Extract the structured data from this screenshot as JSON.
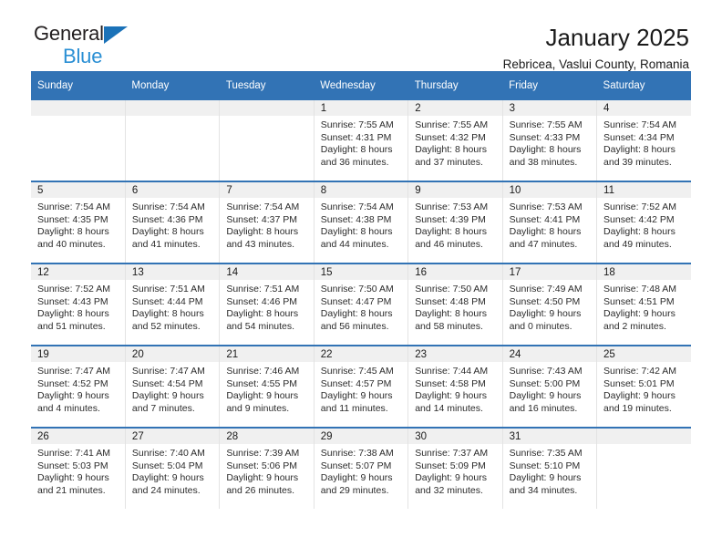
{
  "brand": {
    "name_part1": "General",
    "name_part2": "Blue",
    "triangle_color": "#1b72b8",
    "blue_color": "#2a8fd4"
  },
  "header": {
    "title": "January 2025",
    "subtitle": "Rebricea, Vaslui County, Romania"
  },
  "theme": {
    "header_bg": "#3273b5",
    "daynum_bg": "#f0f0f0",
    "row_border": "#3273b5"
  },
  "weekday_headers": [
    "Sunday",
    "Monday",
    "Tuesday",
    "Wednesday",
    "Thursday",
    "Friday",
    "Saturday"
  ],
  "weeks": [
    [
      {
        "day": "",
        "lines": []
      },
      {
        "day": "",
        "lines": []
      },
      {
        "day": "",
        "lines": []
      },
      {
        "day": "1",
        "lines": [
          "Sunrise: 7:55 AM",
          "Sunset: 4:31 PM",
          "Daylight: 8 hours",
          "and 36 minutes."
        ]
      },
      {
        "day": "2",
        "lines": [
          "Sunrise: 7:55 AM",
          "Sunset: 4:32 PM",
          "Daylight: 8 hours",
          "and 37 minutes."
        ]
      },
      {
        "day": "3",
        "lines": [
          "Sunrise: 7:55 AM",
          "Sunset: 4:33 PM",
          "Daylight: 8 hours",
          "and 38 minutes."
        ]
      },
      {
        "day": "4",
        "lines": [
          "Sunrise: 7:54 AM",
          "Sunset: 4:34 PM",
          "Daylight: 8 hours",
          "and 39 minutes."
        ]
      }
    ],
    [
      {
        "day": "5",
        "lines": [
          "Sunrise: 7:54 AM",
          "Sunset: 4:35 PM",
          "Daylight: 8 hours",
          "and 40 minutes."
        ]
      },
      {
        "day": "6",
        "lines": [
          "Sunrise: 7:54 AM",
          "Sunset: 4:36 PM",
          "Daylight: 8 hours",
          "and 41 minutes."
        ]
      },
      {
        "day": "7",
        "lines": [
          "Sunrise: 7:54 AM",
          "Sunset: 4:37 PM",
          "Daylight: 8 hours",
          "and 43 minutes."
        ]
      },
      {
        "day": "8",
        "lines": [
          "Sunrise: 7:54 AM",
          "Sunset: 4:38 PM",
          "Daylight: 8 hours",
          "and 44 minutes."
        ]
      },
      {
        "day": "9",
        "lines": [
          "Sunrise: 7:53 AM",
          "Sunset: 4:39 PM",
          "Daylight: 8 hours",
          "and 46 minutes."
        ]
      },
      {
        "day": "10",
        "lines": [
          "Sunrise: 7:53 AM",
          "Sunset: 4:41 PM",
          "Daylight: 8 hours",
          "and 47 minutes."
        ]
      },
      {
        "day": "11",
        "lines": [
          "Sunrise: 7:52 AM",
          "Sunset: 4:42 PM",
          "Daylight: 8 hours",
          "and 49 minutes."
        ]
      }
    ],
    [
      {
        "day": "12",
        "lines": [
          "Sunrise: 7:52 AM",
          "Sunset: 4:43 PM",
          "Daylight: 8 hours",
          "and 51 minutes."
        ]
      },
      {
        "day": "13",
        "lines": [
          "Sunrise: 7:51 AM",
          "Sunset: 4:44 PM",
          "Daylight: 8 hours",
          "and 52 minutes."
        ]
      },
      {
        "day": "14",
        "lines": [
          "Sunrise: 7:51 AM",
          "Sunset: 4:46 PM",
          "Daylight: 8 hours",
          "and 54 minutes."
        ]
      },
      {
        "day": "15",
        "lines": [
          "Sunrise: 7:50 AM",
          "Sunset: 4:47 PM",
          "Daylight: 8 hours",
          "and 56 minutes."
        ]
      },
      {
        "day": "16",
        "lines": [
          "Sunrise: 7:50 AM",
          "Sunset: 4:48 PM",
          "Daylight: 8 hours",
          "and 58 minutes."
        ]
      },
      {
        "day": "17",
        "lines": [
          "Sunrise: 7:49 AM",
          "Sunset: 4:50 PM",
          "Daylight: 9 hours",
          "and 0 minutes."
        ]
      },
      {
        "day": "18",
        "lines": [
          "Sunrise: 7:48 AM",
          "Sunset: 4:51 PM",
          "Daylight: 9 hours",
          "and 2 minutes."
        ]
      }
    ],
    [
      {
        "day": "19",
        "lines": [
          "Sunrise: 7:47 AM",
          "Sunset: 4:52 PM",
          "Daylight: 9 hours",
          "and 4 minutes."
        ]
      },
      {
        "day": "20",
        "lines": [
          "Sunrise: 7:47 AM",
          "Sunset: 4:54 PM",
          "Daylight: 9 hours",
          "and 7 minutes."
        ]
      },
      {
        "day": "21",
        "lines": [
          "Sunrise: 7:46 AM",
          "Sunset: 4:55 PM",
          "Daylight: 9 hours",
          "and 9 minutes."
        ]
      },
      {
        "day": "22",
        "lines": [
          "Sunrise: 7:45 AM",
          "Sunset: 4:57 PM",
          "Daylight: 9 hours",
          "and 11 minutes."
        ]
      },
      {
        "day": "23",
        "lines": [
          "Sunrise: 7:44 AM",
          "Sunset: 4:58 PM",
          "Daylight: 9 hours",
          "and 14 minutes."
        ]
      },
      {
        "day": "24",
        "lines": [
          "Sunrise: 7:43 AM",
          "Sunset: 5:00 PM",
          "Daylight: 9 hours",
          "and 16 minutes."
        ]
      },
      {
        "day": "25",
        "lines": [
          "Sunrise: 7:42 AM",
          "Sunset: 5:01 PM",
          "Daylight: 9 hours",
          "and 19 minutes."
        ]
      }
    ],
    [
      {
        "day": "26",
        "lines": [
          "Sunrise: 7:41 AM",
          "Sunset: 5:03 PM",
          "Daylight: 9 hours",
          "and 21 minutes."
        ]
      },
      {
        "day": "27",
        "lines": [
          "Sunrise: 7:40 AM",
          "Sunset: 5:04 PM",
          "Daylight: 9 hours",
          "and 24 minutes."
        ]
      },
      {
        "day": "28",
        "lines": [
          "Sunrise: 7:39 AM",
          "Sunset: 5:06 PM",
          "Daylight: 9 hours",
          "and 26 minutes."
        ]
      },
      {
        "day": "29",
        "lines": [
          "Sunrise: 7:38 AM",
          "Sunset: 5:07 PM",
          "Daylight: 9 hours",
          "and 29 minutes."
        ]
      },
      {
        "day": "30",
        "lines": [
          "Sunrise: 7:37 AM",
          "Sunset: 5:09 PM",
          "Daylight: 9 hours",
          "and 32 minutes."
        ]
      },
      {
        "day": "31",
        "lines": [
          "Sunrise: 7:35 AM",
          "Sunset: 5:10 PM",
          "Daylight: 9 hours",
          "and 34 minutes."
        ]
      },
      {
        "day": "",
        "lines": []
      }
    ]
  ]
}
